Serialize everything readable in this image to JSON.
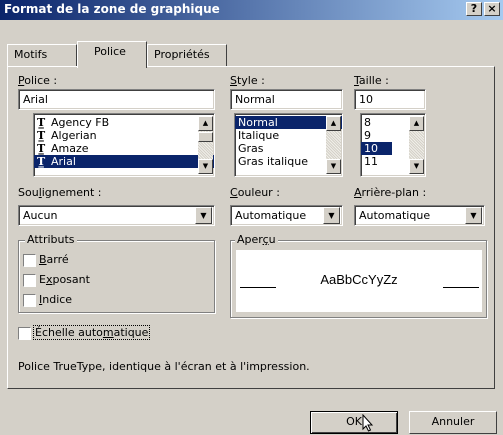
{
  "window": {
    "title": "Format de la zone de graphique",
    "help_label": "?",
    "close_label": "×"
  },
  "tabs": [
    {
      "label": "Motifs",
      "active": false
    },
    {
      "label": "Police",
      "active": true
    },
    {
      "label": "Propriétés",
      "active": false
    }
  ],
  "font": {
    "label_accel": "P",
    "label_rest": "olice :",
    "value": "Arial",
    "items": [
      "Agency FB",
      "Algerian",
      "Amaze",
      "Arial"
    ],
    "selected_index": 3
  },
  "style": {
    "label_accel": "S",
    "label_rest": "tyle :",
    "value": "Normal",
    "items": [
      "Normal",
      "Italique",
      "Gras",
      "Gras italique"
    ],
    "selected_index": 0
  },
  "size": {
    "label_accel": "T",
    "label_rest": "aille :",
    "value": "10",
    "items": [
      "8",
      "9",
      "10",
      "11"
    ],
    "selected_index": 2
  },
  "underline": {
    "label_pre": "Sou",
    "label_accel": "l",
    "label_rest": "ignement :",
    "value": "Aucun"
  },
  "color": {
    "label_accel": "C",
    "label_rest": "ouleur :",
    "value": "Automatique"
  },
  "background": {
    "label_accel": "A",
    "label_rest": "rrière-plan :",
    "value": "Automatique"
  },
  "attributes": {
    "title": "Attributs",
    "items": [
      {
        "pre": "",
        "accel": "B",
        "rest": "arré",
        "checked": false
      },
      {
        "pre": "E",
        "accel": "x",
        "rest": "posant",
        "checked": false
      },
      {
        "pre": "",
        "accel": "I",
        "rest": "ndice",
        "checked": false
      }
    ]
  },
  "preview": {
    "title_pre": "Aper",
    "title_accel": "ç",
    "title_rest": "u",
    "sample": "AaBbCcYyZz"
  },
  "autoscale": {
    "label_pre": "Échelle auto",
    "label_accel": "m",
    "label_rest": "atique",
    "checked": false
  },
  "info_text": "Police TrueType, identique à l'écran et à l'impression.",
  "buttons": {
    "ok": "OK",
    "cancel": "Annuler"
  }
}
